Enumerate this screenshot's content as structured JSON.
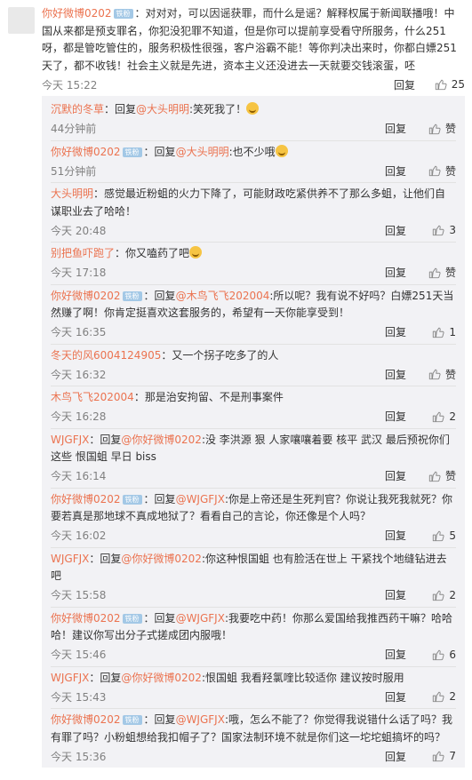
{
  "main_comment": {
    "username": "你好微博0202",
    "badge": "铁粉",
    "text": "：对对对，可以因谣获罪，而什么是谣？解释权属于新闻联播哦！中国从来都是预支罪名，你犯没犯罪不知道，但是你可以提前享受看守所服务，什么251呀，都是管吃管住的，服务积极性很强，客户浴霸不能！等你判决出来时，你都白嫖251天了，都不收钱！社会主义就是先进，资本主义还没进去一天就要交钱滚蛋，呸",
    "time": "今天 15:22",
    "reply_label": "回复",
    "likes": "25"
  },
  "replies": [
    {
      "username": "沉默的冬草",
      "badge": "",
      "prefix": "：回复",
      "mention": "@大头明明",
      "text": ":笑死我了！",
      "emoji": true,
      "time": "44分钟前",
      "reply_label": "回复",
      "likes": "赞"
    },
    {
      "username": "你好微博0202",
      "badge": "铁粉",
      "prefix": "：回复",
      "mention": "@大头明明",
      "text": ":也不少哦",
      "emoji": true,
      "time": "51分钟前",
      "reply_label": "回复",
      "likes": "赞"
    },
    {
      "username": "大头明明",
      "badge": "",
      "prefix": "",
      "mention": "",
      "text": "：感觉最近粉蛆的火力下降了，可能财政吃紧供养不了那么多蛆，让他们自谋职业去了哈哈！",
      "emoji": false,
      "time": "今天 20:48",
      "reply_label": "回复",
      "likes": "3"
    },
    {
      "username": "别把鱼吓跑了",
      "badge": "",
      "prefix": "",
      "mention": "",
      "text": "：你又嗑药了吧",
      "emoji": true,
      "time": "今天 17:18",
      "reply_label": "回复",
      "likes": "赞"
    },
    {
      "username": "你好微博0202",
      "badge": "铁粉",
      "prefix": "：回复",
      "mention": "@木鸟飞飞202004",
      "text": ":所以呢？我有说不好吗？白嫖251天当然赚了啊！你肯定挺喜欢这套服务的，希望有一天你能享受到！",
      "emoji": false,
      "time": "今天 16:35",
      "reply_label": "回复",
      "likes": "1"
    },
    {
      "username": "冬天的风6004124905",
      "badge": "",
      "prefix": "",
      "mention": "",
      "text": "：又一个拐子吃多了的人",
      "emoji": false,
      "time": "今天 16:32",
      "reply_label": "回复",
      "likes": "赞"
    },
    {
      "username": "木鸟飞飞202004",
      "badge": "",
      "prefix": "",
      "mention": "",
      "text": "：那是治安拘留、不是刑事案件",
      "emoji": false,
      "time": "今天 16:28",
      "reply_label": "回复",
      "likes": "2"
    },
    {
      "username": "WJGFJX",
      "badge": "",
      "prefix": "：回复",
      "mention": "@你好微博0202",
      "text": ":没 李洪源  狠 人家嚷嚷着要  核平  武汉    最后预祝你们这些 恨国蛆  早日 biss",
      "emoji": false,
      "time": "今天 16:14",
      "reply_label": "回复",
      "likes": "赞"
    },
    {
      "username": "你好微博0202",
      "badge": "铁粉",
      "prefix": "：回复",
      "mention": "@WJGFJX",
      "text": ":你是上帝还是生死判官？你说让我死我就死？你要若真是那地球不真成地狱了？看看自己的言论，你还像是个人吗？",
      "emoji": false,
      "time": "今天 16:02",
      "reply_label": "回复",
      "likes": "5"
    },
    {
      "username": "WJGFJX",
      "badge": "",
      "prefix": "：回复",
      "mention": "@你好微博0202",
      "text": ":你这种恨国蛆  也有脸活在世上  干紧找个地缝钻进去吧",
      "emoji": false,
      "time": "今天 15:58",
      "reply_label": "回复",
      "likes": "2"
    },
    {
      "username": "你好微博0202",
      "badge": "铁粉",
      "prefix": "：回复",
      "mention": "@WJGFJX",
      "text": ":我要吃中药！你那么爱国给我推西药干嘛？哈哈哈！建议你写出分子式搓成团内服哦！",
      "emoji": false,
      "time": "今天 15:46",
      "reply_label": "回复",
      "likes": "6"
    },
    {
      "username": "WJGFJX",
      "badge": "",
      "prefix": "：回复",
      "mention": "@你好微博0202",
      "text": ":恨国蛆  我看羟氯喹比较适你  建议按时服用",
      "emoji": false,
      "time": "今天 15:43",
      "reply_label": "回复",
      "likes": "2"
    },
    {
      "username": "你好微博0202",
      "badge": "铁粉",
      "prefix": "：回复",
      "mention": "@WJGFJX",
      "text": ":哦，怎么不能了？你觉得我说错什么话了吗？我有罪了吗？小粉蛆想给我扣帽子了？国家法制环境不就是你们这一坨坨蛆搞坏的吗？",
      "emoji": false,
      "time": "今天 15:36",
      "reply_label": "回复",
      "likes": "7"
    }
  ],
  "icons": {
    "like": "thumbs-up-icon",
    "avatar": "user-avatar"
  },
  "colors": {
    "username": "#eb7350",
    "badge": "#a3c8e6",
    "reply_bg": "#f2f2f5"
  }
}
